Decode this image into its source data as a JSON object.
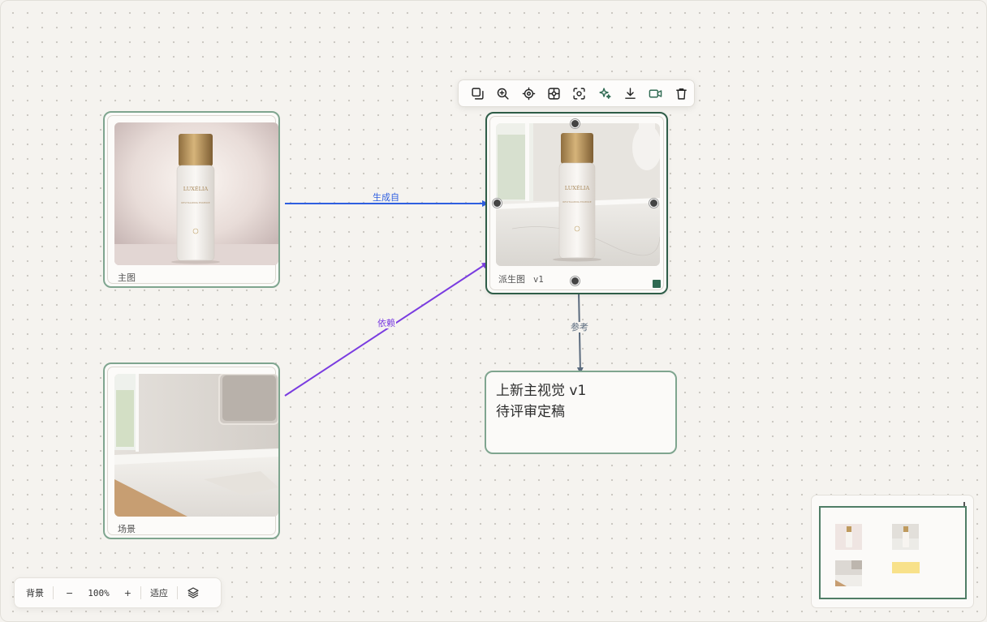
{
  "toolbar": {
    "icons": [
      "copy-icon",
      "zoom-in-icon",
      "locate-icon",
      "focus-frame-icon",
      "scan-icon",
      "ai-sparkle-icon",
      "download-icon",
      "video-icon",
      "trash-icon"
    ],
    "accent": "#2f6a52"
  },
  "nodes": {
    "main": {
      "label": "主图"
    },
    "scene": {
      "label": "场景"
    },
    "derived": {
      "label": "派生图",
      "version": "v1"
    }
  },
  "product": {
    "brand": "LUXÉLIA",
    "subtitle": "REVITALIZING ESSENCE"
  },
  "edges": {
    "generated_from": {
      "label": "生成自",
      "color": "#2f5fe0"
    },
    "depends_on": {
      "label": "依赖",
      "color": "#7a3ce0"
    },
    "reference": {
      "label": "参考",
      "color": "#5b6b7e"
    }
  },
  "note": {
    "line1": "上新主视觉 v1",
    "line2": "待评审定稿"
  },
  "bottom_bar": {
    "background": "背景",
    "zoom_out": "−",
    "zoom_level": "100%",
    "zoom_in": "+",
    "fit": "适应",
    "layers_icon": "layers-icon"
  },
  "colors": {
    "node_border": "#7fa58f",
    "selected_border": "#2f5d48",
    "canvas": "#f5f3ef"
  }
}
